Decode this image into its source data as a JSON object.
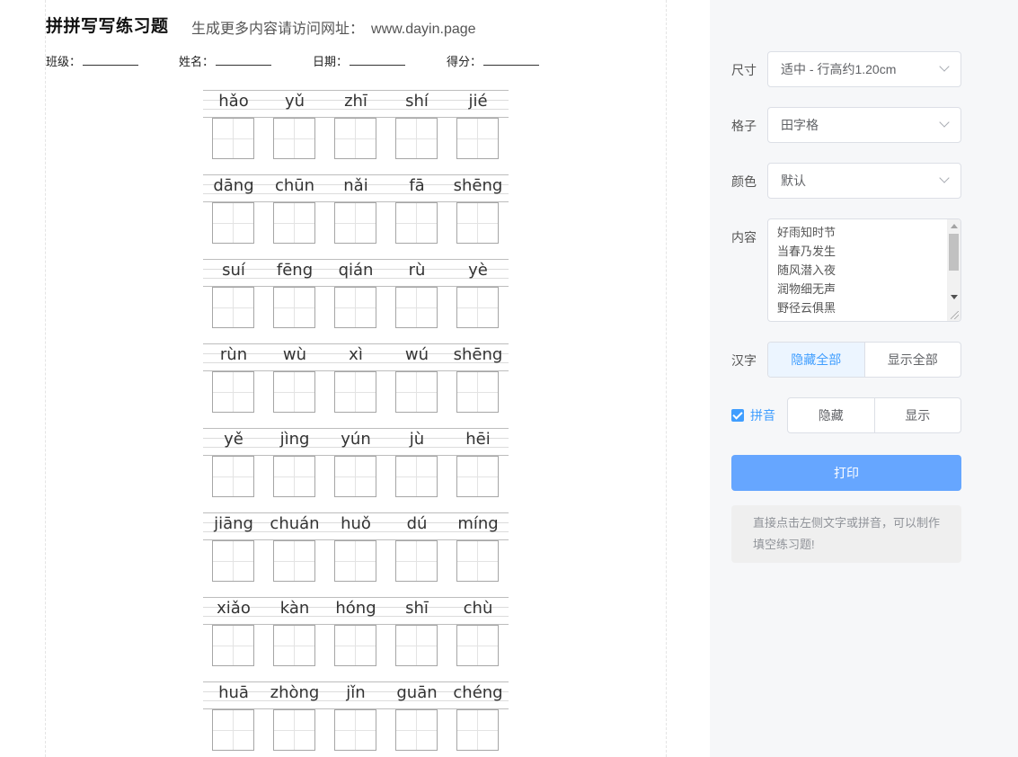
{
  "sheet": {
    "title": "拼拼写写练习题",
    "subtitle": "生成更多内容请访问网址：",
    "url": "www.dayin.page",
    "fields": [
      {
        "label": "班级："
      },
      {
        "label": "姓名："
      },
      {
        "label": "日期："
      },
      {
        "label": "得分："
      }
    ],
    "rows": [
      [
        "hǎo",
        "yǔ",
        "zhī",
        "shí",
        "jié"
      ],
      [
        "dāng",
        "chūn",
        "nǎi",
        "fā",
        "shēng"
      ],
      [
        "suí",
        "fēng",
        "qián",
        "rù",
        "yè"
      ],
      [
        "rùn",
        "wù",
        "xì",
        "wú",
        "shēng"
      ],
      [
        "yě",
        "jìng",
        "yún",
        "jù",
        "hēi"
      ],
      [
        "jiāng",
        "chuán",
        "huǒ",
        "dú",
        "míng"
      ],
      [
        "xiǎo",
        "kàn",
        "hóng",
        "shī",
        "chù"
      ],
      [
        "huā",
        "zhòng",
        "jǐn",
        "guān",
        "chéng"
      ]
    ]
  },
  "panel": {
    "size": {
      "label": "尺寸",
      "value": "适中 - 行高约1.20cm"
    },
    "grid": {
      "label": "格子",
      "value": "田字格"
    },
    "color": {
      "label": "颜色",
      "value": "默认"
    },
    "content": {
      "label": "内容",
      "lines": [
        "好雨知时节",
        "当春乃发生",
        "随风潜入夜",
        "润物细无声",
        "野径云俱黑"
      ]
    },
    "hanzi": {
      "label": "汉字",
      "options": [
        "隐藏全部",
        "显示全部"
      ],
      "active": 0
    },
    "pinyin": {
      "label": "拼音",
      "checked": true,
      "options": [
        "隐藏",
        "显示"
      ]
    },
    "print_label": "打印",
    "tip": "直接点击左侧文字或拼音，可以制作填空练习题!"
  }
}
